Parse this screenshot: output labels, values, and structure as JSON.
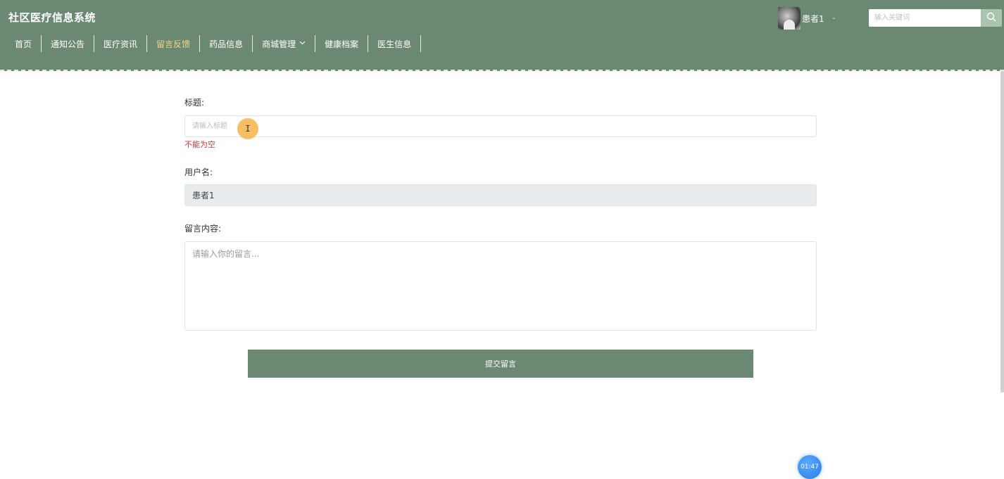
{
  "brand": "社区医疗信息系统",
  "nav": {
    "items": [
      {
        "label": "首页"
      },
      {
        "label": "通知公告"
      },
      {
        "label": "医疗资讯"
      },
      {
        "label": "留言反馈"
      },
      {
        "label": "药品信息"
      },
      {
        "label": "商城管理"
      },
      {
        "label": "健康档案"
      },
      {
        "label": "医生信息"
      }
    ],
    "active": "留言反馈"
  },
  "user": {
    "name": "患者1",
    "caret": "-"
  },
  "search": {
    "placeholder": "输入关键词",
    "icon": "search-icon"
  },
  "form": {
    "title_label": "标题:",
    "title_placeholder": "请输入标题",
    "title_error": "不能为空",
    "username_label": "用户名:",
    "username_value": "患者1",
    "content_label": "留言内容:",
    "content_placeholder": "请输入你的留言..."
  },
  "submit_label": "提交留言",
  "timer": "01:47",
  "cursor_glyph": "I",
  "colors": {
    "header_bg": "#6b8872",
    "active_nav": "#f3d58a",
    "error": "#d0393e",
    "search_button": "#a9c5ad"
  }
}
